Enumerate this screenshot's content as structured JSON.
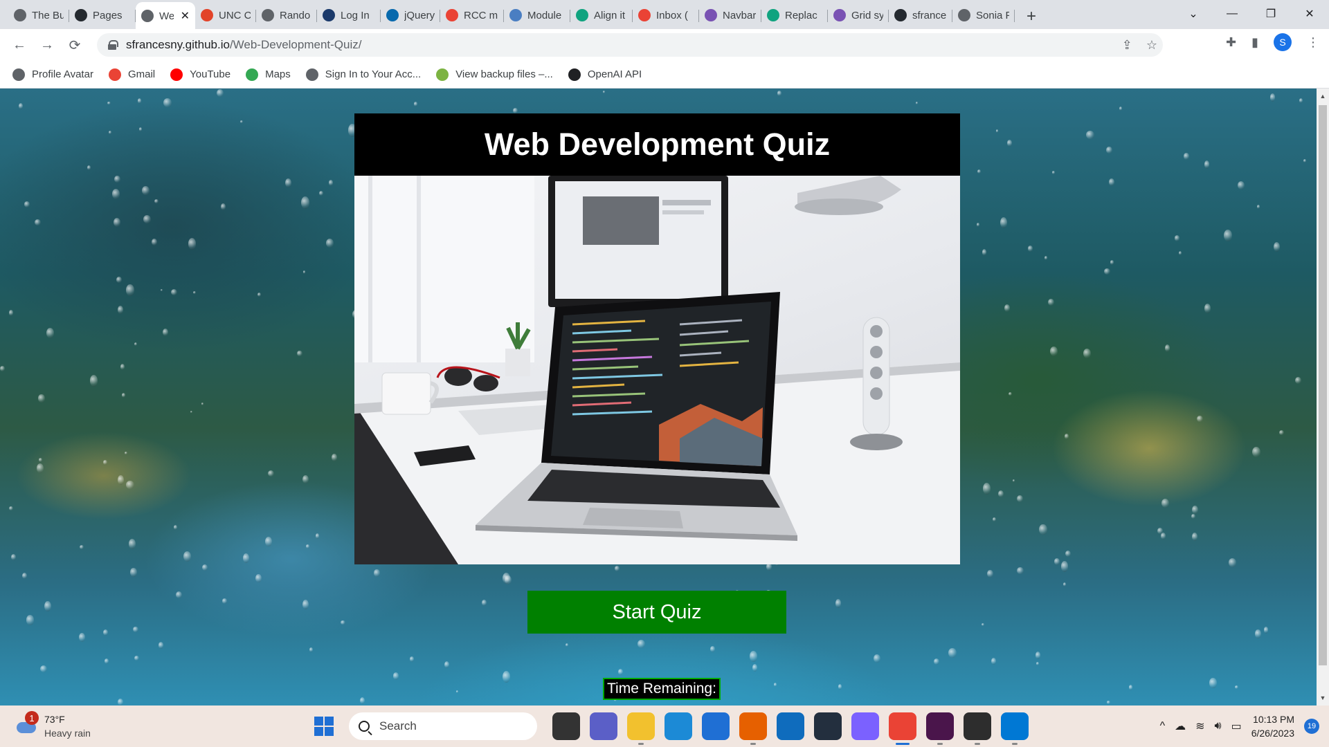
{
  "browser": {
    "tabs": [
      {
        "title": "The Bu",
        "favicon": "#5f6368",
        "active": false
      },
      {
        "title": "Pages",
        "favicon": "#24292f",
        "active": false
      },
      {
        "title": "We",
        "favicon": "#5f6368",
        "active": true
      },
      {
        "title": "UNC C",
        "favicon": "#e24329",
        "active": false
      },
      {
        "title": "Rando",
        "favicon": "#5f6368",
        "active": false
      },
      {
        "title": "Log In",
        "favicon": "#1b3a6b",
        "active": false
      },
      {
        "title": "jQuery",
        "favicon": "#0769ad",
        "active": false
      },
      {
        "title": "RCC m",
        "favicon": "#ea4335",
        "active": false
      },
      {
        "title": "Module",
        "favicon": "#4a7ec2",
        "active": false
      },
      {
        "title": "Align it",
        "favicon": "#10a37f",
        "active": false
      },
      {
        "title": "Inbox (",
        "favicon": "#ea4335",
        "active": false
      },
      {
        "title": "Navbar",
        "favicon": "#7952b3",
        "active": false
      },
      {
        "title": "Replac",
        "favicon": "#10a37f",
        "active": false
      },
      {
        "title": "Grid sy",
        "favicon": "#7952b3",
        "active": false
      },
      {
        "title": "sfrance",
        "favicon": "#24292f",
        "active": false
      },
      {
        "title": "Sonia F",
        "favicon": "#5f6368",
        "active": false
      }
    ],
    "new_tab_glyph": "+",
    "close_glyph": "✕",
    "window_controls": {
      "dropdown": "⌄",
      "minimize": "—",
      "restore": "❐",
      "close": "✕"
    },
    "url_host": "sfrancesny.github.io",
    "url_path": "/Web-Development-Quiz/",
    "nav": {
      "back": "←",
      "forward": "→",
      "reload": "⟳"
    },
    "toolbar_icons": {
      "share": "⇪",
      "star": "☆",
      "extensions": "✚",
      "sidepanel": "▮",
      "menu": "⋮"
    },
    "profile_initial": "S",
    "bookmarks": [
      {
        "label": "Profile Avatar",
        "icon": "globe-icon",
        "color": "#5f6368"
      },
      {
        "label": "Gmail",
        "icon": "gmail-icon",
        "color": "#ea4335"
      },
      {
        "label": "YouTube",
        "icon": "youtube-icon",
        "color": "#ff0000"
      },
      {
        "label": "Maps",
        "icon": "maps-icon",
        "color": "#34a853"
      },
      {
        "label": "Sign In to Your Acc...",
        "icon": "globe-icon",
        "color": "#5f6368"
      },
      {
        "label": "View backup files –...",
        "icon": "backup-icon",
        "color": "#7cb342"
      },
      {
        "label": "OpenAI API",
        "icon": "openai-icon",
        "color": "#202124"
      }
    ]
  },
  "page": {
    "title": "Web Development Quiz",
    "start_button": "Start Quiz",
    "timer_label": "Time Remaining:"
  },
  "taskbar": {
    "weather_temp": "73°F",
    "weather_desc": "Heavy rain",
    "weather_badge": "1",
    "search_label": "Search",
    "apps": [
      {
        "name": "task-view-icon",
        "color": "#333",
        "running": false
      },
      {
        "name": "teams-chat-icon",
        "color": "#5b5fc7",
        "running": false
      },
      {
        "name": "file-explorer-icon",
        "color": "#f2c12e",
        "running": true
      },
      {
        "name": "edge-icon",
        "color": "#1c8ad6",
        "running": false
      },
      {
        "name": "store-icon",
        "color": "#1f6fd4",
        "running": false
      },
      {
        "name": "firefox-icon",
        "color": "#e66000",
        "running": true
      },
      {
        "name": "mail-icon",
        "color": "#0f6cbd",
        "running": false
      },
      {
        "name": "amazon-icon",
        "color": "#232f3e",
        "running": false
      },
      {
        "name": "copilot-icon",
        "color": "#7b61ff",
        "running": false
      },
      {
        "name": "chrome-icon",
        "color": "#ea4335",
        "running": true,
        "active": true
      },
      {
        "name": "slack-icon",
        "color": "#4a154b",
        "running": true
      },
      {
        "name": "terminal-icon",
        "color": "#2d2d2d",
        "running": true
      },
      {
        "name": "vscode-icon",
        "color": "#0078d4",
        "running": true
      }
    ],
    "tray_chevron": "^",
    "time": "10:13 PM",
    "date": "6/26/2023",
    "notification_count": "19"
  }
}
